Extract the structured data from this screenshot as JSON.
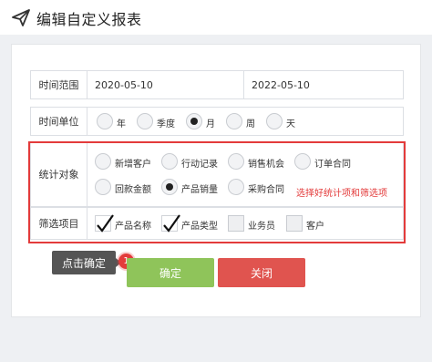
{
  "header": {
    "title": "编辑自定义报表",
    "icon": "paper-plane-icon"
  },
  "date_range": {
    "label": "时间范围",
    "start": "2020-05-10",
    "end": "2022-05-10"
  },
  "time_unit": {
    "label": "时间单位",
    "options": [
      "年",
      "季度",
      "月",
      "周",
      "天"
    ],
    "selected": "月"
  },
  "stat_target": {
    "label": "统计对象",
    "options": [
      "新增客户",
      "行动记录",
      "销售机会",
      "订单合同",
      "回款金额",
      "产品销量",
      "采购合同"
    ],
    "selected": "产品销量"
  },
  "filter": {
    "label": "筛选项目",
    "options": [
      {
        "label": "产品名称",
        "checked": true
      },
      {
        "label": "产品类型",
        "checked": true
      },
      {
        "label": "业务员",
        "checked": false
      },
      {
        "label": "客户",
        "checked": false
      }
    ]
  },
  "annotation": {
    "highlight_note": "选择好统计项和筛选项",
    "tooltip": "点击确定",
    "step_badge": "1",
    "color": "#e33b3b"
  },
  "buttons": {
    "confirm": "确定",
    "close": "关闭",
    "confirm_color": "#8fc45a",
    "close_color": "#e0544f"
  }
}
